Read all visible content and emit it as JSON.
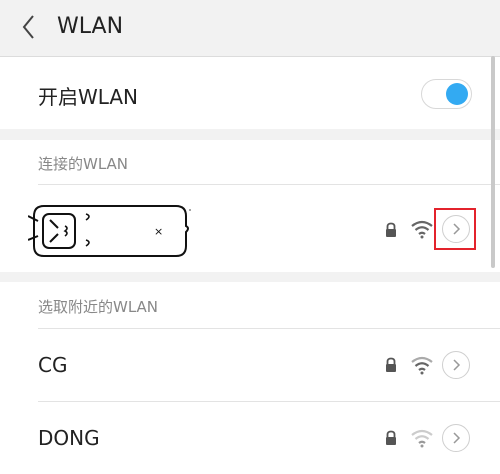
{
  "header": {
    "title": "WLAN"
  },
  "toggle_row": {
    "label": "开启WLAN",
    "enabled": true
  },
  "connected": {
    "section_title": "连接的WLAN",
    "network": {
      "name": "",
      "secured": true,
      "signal_level": 3
    }
  },
  "nearby": {
    "section_title": "选取附近的WLAN",
    "networks": [
      {
        "name": "CG",
        "secured": true,
        "signal_level": 3
      },
      {
        "name": "DONG",
        "secured": true,
        "signal_level": 1
      }
    ]
  },
  "colors": {
    "accent": "#33aaf2",
    "highlight": "#e3232c"
  }
}
